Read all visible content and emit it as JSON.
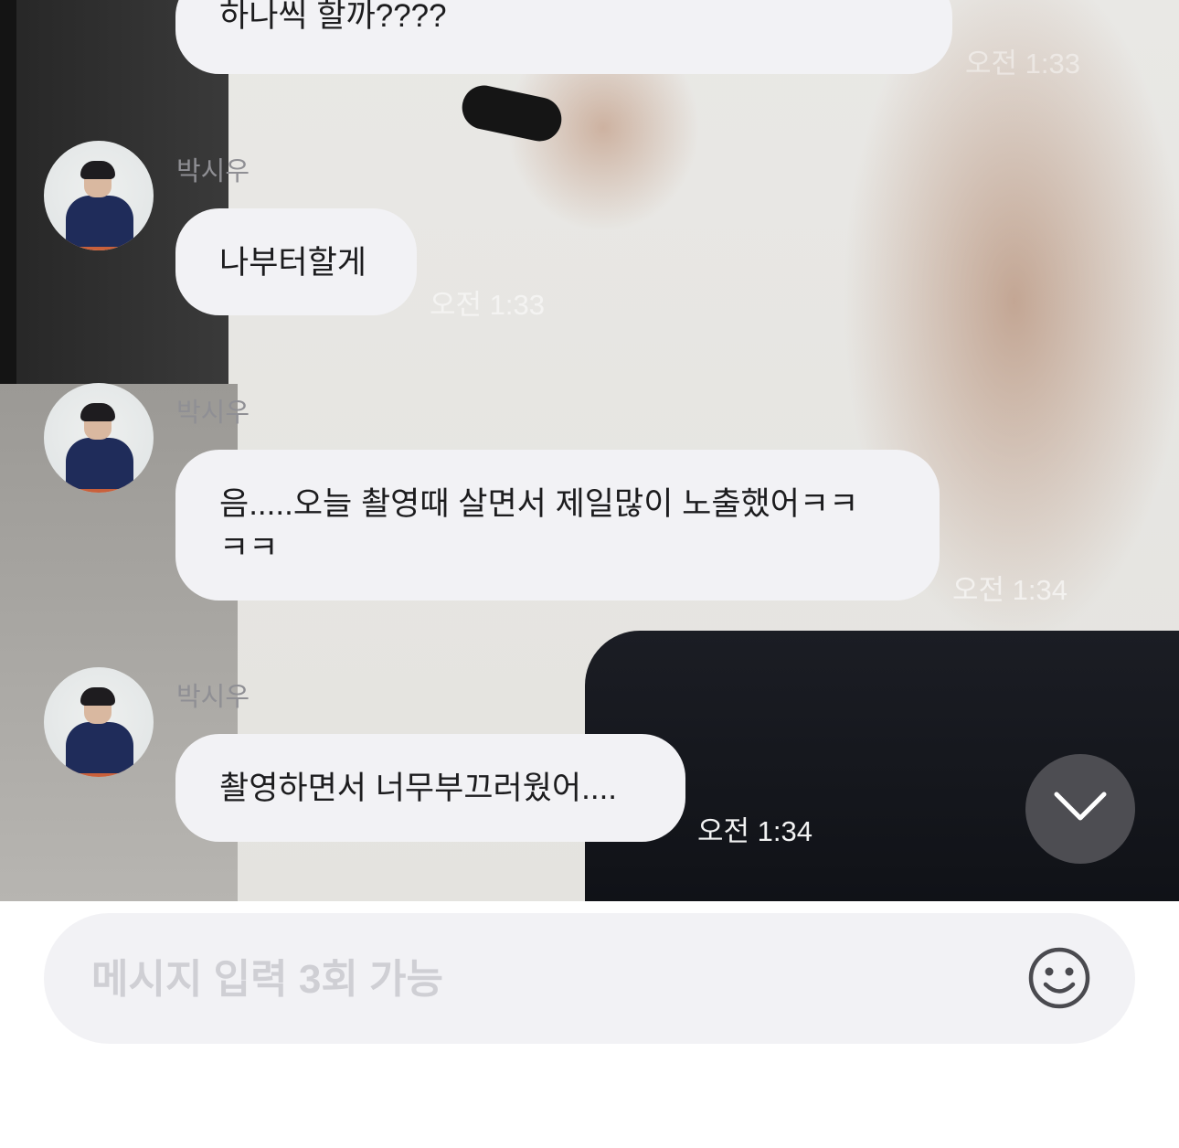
{
  "chat": {
    "messages": [
      {
        "sender": "",
        "text": "하나씩 할까????",
        "time": "오전 1:33"
      },
      {
        "sender": "박시우",
        "text": "나부터할게",
        "time": "오전 1:33"
      },
      {
        "sender": "박시우",
        "text": "음.....오늘 촬영때 살면서 제일많이 노출했어ㅋㅋ ㅋㅋ",
        "time": "오전 1:34"
      },
      {
        "sender": "박시우",
        "text": "촬영하면서 너무부끄러웠어....",
        "time": "오전 1:34"
      }
    ]
  },
  "input": {
    "placeholder": "메시지 입력 3회 가능",
    "value": ""
  },
  "icons": {
    "scroll_down": "chevron-down-icon",
    "emoji": "smiley-icon"
  },
  "colors": {
    "bubble": "#f2f2f5",
    "name_text": "#8f8f94",
    "scroll_button": "#4d4d52",
    "placeholder": "#cfcfd4"
  }
}
